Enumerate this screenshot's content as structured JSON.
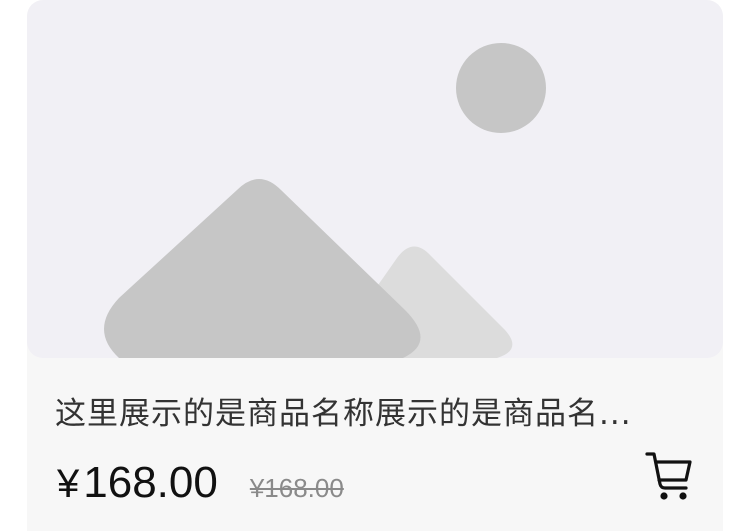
{
  "product": {
    "image_icon": "image-placeholder-icon",
    "name": "这里展示的是商品名称展示的是商品名...",
    "price": "168.00",
    "currency_symbol": "¥",
    "original_price": "¥168.00",
    "cart_icon": "cart-icon"
  },
  "colors": {
    "card_background": "#f7f7f7",
    "image_background": "#f1f0f5",
    "placeholder_shape": "#c6c6c6",
    "placeholder_shape_light": "#dcdcdc",
    "price_text": "#111111",
    "original_price_text": "#8a8a8a"
  }
}
